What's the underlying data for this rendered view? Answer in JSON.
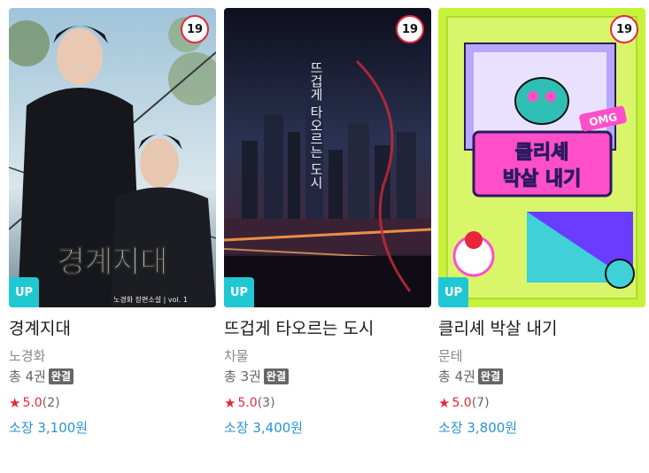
{
  "books": [
    {
      "title": "경계지대",
      "author": "노경화",
      "volumes": "총 4권",
      "status_badge": "완결",
      "age_rating": "19",
      "up_badge": "UP",
      "rating": "5.0",
      "rating_count": "(2)",
      "price": "소장 3,100원",
      "cover": {
        "title_text": "경계지대",
        "subtitle": "노경화 장편소설 | vol. 1",
        "palette": [
          "#0f1014",
          "#4b6a7c",
          "#9ec0d5",
          "#f0ede6"
        ]
      }
    },
    {
      "title": "뜨겁게 타오르는 도시",
      "author": "차물",
      "volumes": "총 3권",
      "status_badge": "완결",
      "age_rating": "19",
      "up_badge": "UP",
      "rating": "5.0",
      "rating_count": "(3)",
      "price": "소장 3,400원",
      "cover": {
        "title_text": "뜨겁게 타오르는 도시",
        "palette": [
          "#0c0d1c",
          "#27304f",
          "#ff8a3c",
          "#d02d3c"
        ]
      }
    },
    {
      "title": "클리셰 박살 내기",
      "author": "문테",
      "volumes": "총 4권",
      "status_badge": "완결",
      "age_rating": "19",
      "up_badge": "UP",
      "rating": "5.0",
      "rating_count": "(7)",
      "price": "소장 3,800원",
      "cover": {
        "title_text_line1": "클리셰",
        "title_text_line2": "박살 내기",
        "tag": "OMG",
        "palette": [
          "#c7f23a",
          "#ff4fc8",
          "#6a3cff",
          "#ffffff"
        ]
      }
    }
  ],
  "icons": {
    "rating": "star-icon"
  }
}
